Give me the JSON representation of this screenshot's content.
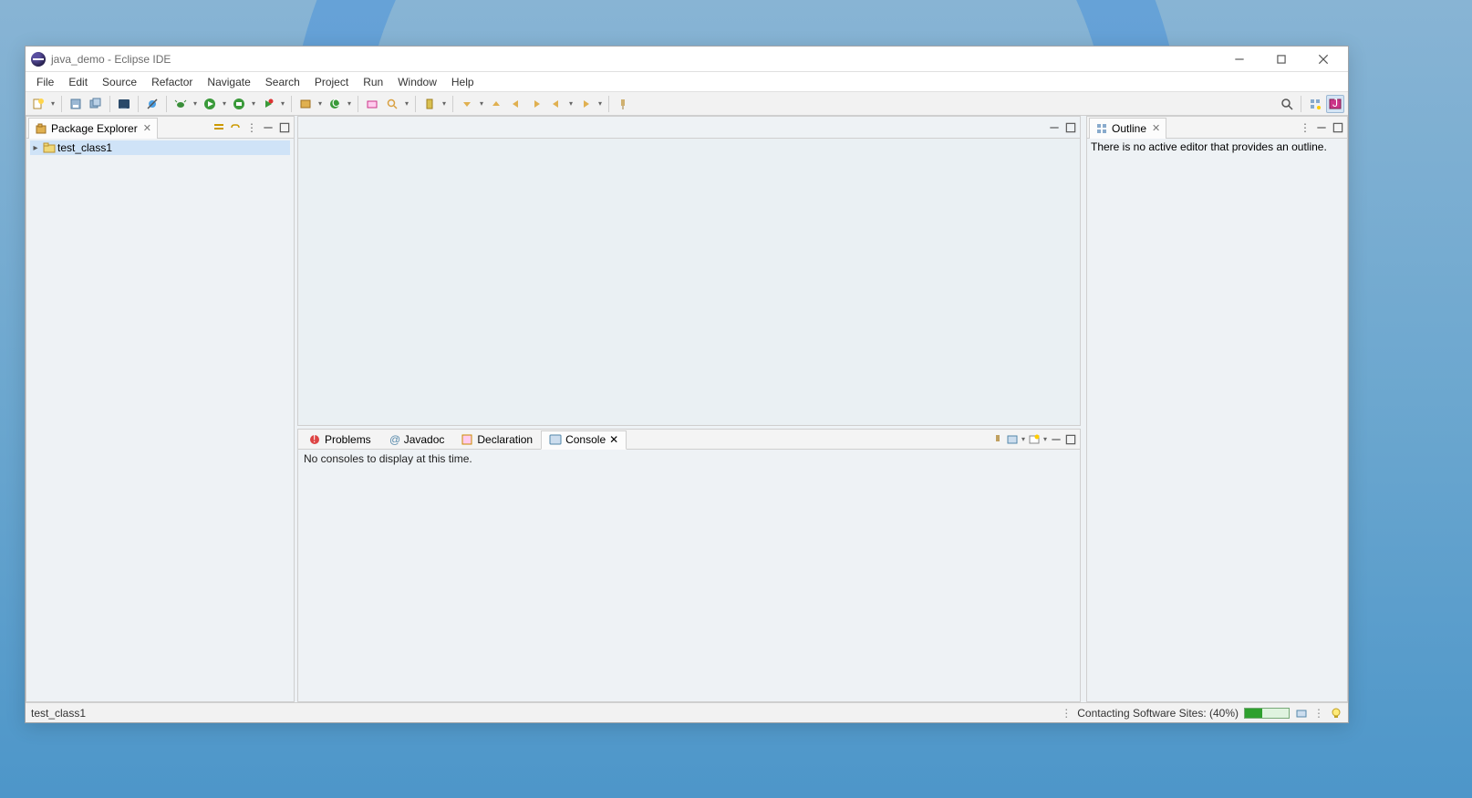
{
  "window": {
    "title": "java_demo - Eclipse IDE"
  },
  "menu": [
    "File",
    "Edit",
    "Source",
    "Refactor",
    "Navigate",
    "Search",
    "Project",
    "Run",
    "Window",
    "Help"
  ],
  "package_explorer": {
    "title": "Package Explorer",
    "items": [
      {
        "label": "test_class1",
        "expanded": false,
        "selected": true
      }
    ]
  },
  "outline": {
    "title": "Outline",
    "empty_msg": "There is no active editor that provides an outline."
  },
  "bottom": {
    "tabs": [
      {
        "label": "Problems"
      },
      {
        "label": "Javadoc"
      },
      {
        "label": "Declaration"
      },
      {
        "label": "Console",
        "active": true
      }
    ],
    "console_empty_msg": "No consoles to display at this time."
  },
  "statusbar": {
    "left": "test_class1",
    "right_msg": "Contacting Software Sites: (40%)",
    "progress_pct": 40
  }
}
